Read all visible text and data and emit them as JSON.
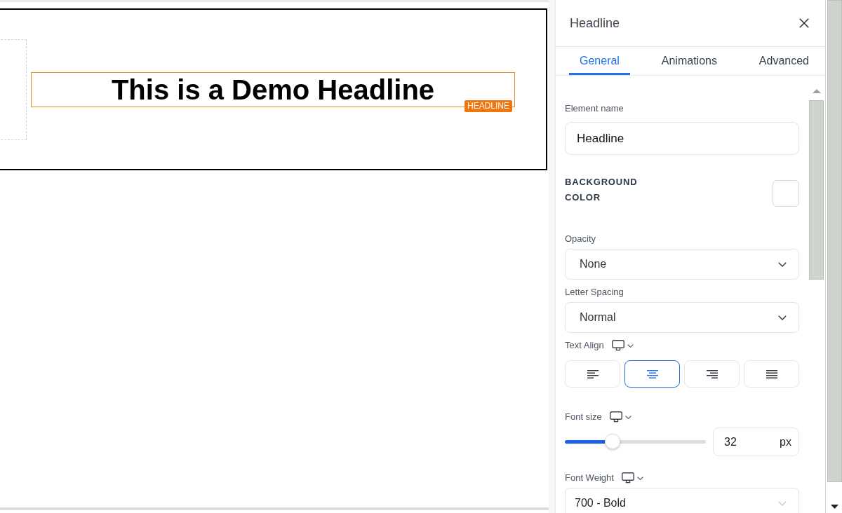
{
  "canvas": {
    "headline": "This is a Demo Headline",
    "badge": "HEADLINE"
  },
  "panel": {
    "title": "Headline",
    "tabs": [
      {
        "label": "General",
        "selected": true
      },
      {
        "label": "Animations",
        "selected": false
      },
      {
        "label": "Advanced",
        "selected": false
      }
    ],
    "fields": [
      {
        "kind": "text",
        "label": "Element name",
        "value": "Headline",
        "responsive": false
      },
      {
        "kind": "color",
        "label": "BACKGROUND COLOR",
        "responsive": false
      },
      {
        "kind": "select",
        "label": "Opacity",
        "value": "None",
        "responsive": false
      },
      {
        "kind": "select",
        "label": "Letter Spacing",
        "value": "Normal",
        "responsive": false
      },
      {
        "kind": "align",
        "label": "Text Align",
        "responsive": true,
        "options": [
          {
            "kind": "left",
            "selected": false
          },
          {
            "kind": "center",
            "selected": true
          },
          {
            "kind": "right",
            "selected": false
          },
          {
            "kind": "justify",
            "selected": false
          }
        ]
      },
      {
        "kind": "slider",
        "label": "Font size",
        "responsive": true,
        "level": 0.34,
        "value": "32",
        "unit": "px"
      },
      {
        "kind": "combo",
        "label": "Font Weight",
        "value": "700 - Bold",
        "responsive": true
      }
    ]
  }
}
